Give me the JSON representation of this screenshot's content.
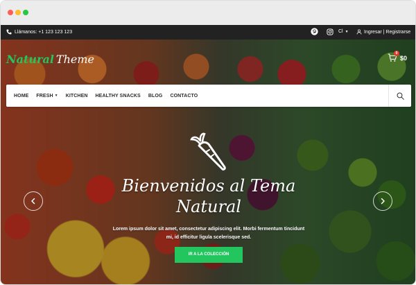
{
  "topbar": {
    "phone_label": "Llámanos: +1 123 123 123",
    "lang_label": "Cl",
    "login_label": "Ingresar | Registrarse",
    "social_icons": [
      "pinterest-icon",
      "instagram-icon"
    ]
  },
  "header": {
    "logo_part1": "Natural",
    "logo_part2": "Theme",
    "cart_count": "0",
    "cart_total": "$0"
  },
  "nav": {
    "items": [
      "HOME",
      "FRESH",
      "KITCHEN",
      "HEALTHY SNACKS",
      "BLOG",
      "CONTACTO"
    ]
  },
  "hero": {
    "title_line1": "Bienvenidos al Tema",
    "title_line2": "Natural",
    "text_line1": "Lorem ipsum dolor sit amet, consectetur adipiscing elit. Morbi fermentum tincidunt",
    "text_line2": "mi, id efficitur ligula scelerisque sed.",
    "cta_label": "IR A LA COLECCIÓN"
  },
  "colors": {
    "accent": "#22c55e",
    "topbar_bg": "#222222",
    "badge": "#e53935"
  }
}
